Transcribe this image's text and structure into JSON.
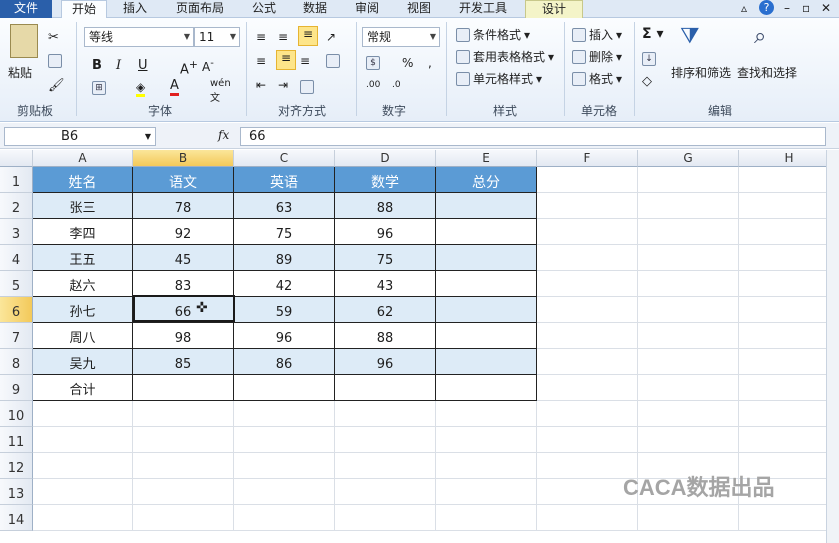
{
  "tabs": [
    "文件",
    "开始",
    "插入",
    "页面布局",
    "公式",
    "数据",
    "审阅",
    "视图",
    "开发工具",
    "设计"
  ],
  "ribbon": {
    "clipboard": {
      "paste": "粘贴",
      "label": "剪贴板"
    },
    "font": {
      "name": "等线",
      "size": "11",
      "label": "字体"
    },
    "align": {
      "label": "对齐方式"
    },
    "number": {
      "format": "常规",
      "label": "数字"
    },
    "styles": {
      "cond": "条件格式",
      "table": "套用表格格式",
      "cell": "单元格样式",
      "label": "样式"
    },
    "cells": {
      "insert": "插入",
      "delete": "删除",
      "format": "格式",
      "label": "单元格"
    },
    "editing": {
      "sort": "排序和筛选",
      "find": "查找和选择",
      "label": "编辑"
    }
  },
  "formula_bar": {
    "name_box": "B6",
    "fx": "fx",
    "value": "66"
  },
  "columns": [
    "A",
    "B",
    "C",
    "D",
    "E",
    "F",
    "G",
    "H"
  ],
  "rows": [
    "1",
    "2",
    "3",
    "4",
    "5",
    "6",
    "7",
    "8",
    "9",
    "10",
    "11",
    "12",
    "13",
    "14"
  ],
  "table": {
    "headers": [
      "姓名",
      "语文",
      "英语",
      "数学",
      "总分"
    ],
    "data": [
      [
        "张三",
        "78",
        "63",
        "88",
        ""
      ],
      [
        "李四",
        "92",
        "75",
        "96",
        ""
      ],
      [
        "王五",
        "45",
        "89",
        "75",
        ""
      ],
      [
        "赵六",
        "83",
        "42",
        "43",
        ""
      ],
      [
        "孙七",
        "66",
        "59",
        "62",
        ""
      ],
      [
        "周八",
        "98",
        "96",
        "88",
        ""
      ],
      [
        "吴九",
        "85",
        "86",
        "96",
        ""
      ],
      [
        "合计",
        "",
        "",
        "",
        ""
      ]
    ]
  },
  "watermark": "CACA数据出品",
  "colors": {
    "header_fill": "#5b9bd5",
    "band_fill": "#ddebf7",
    "file_tab": "#2a5faa",
    "active_highlight": "#f3c95a"
  }
}
